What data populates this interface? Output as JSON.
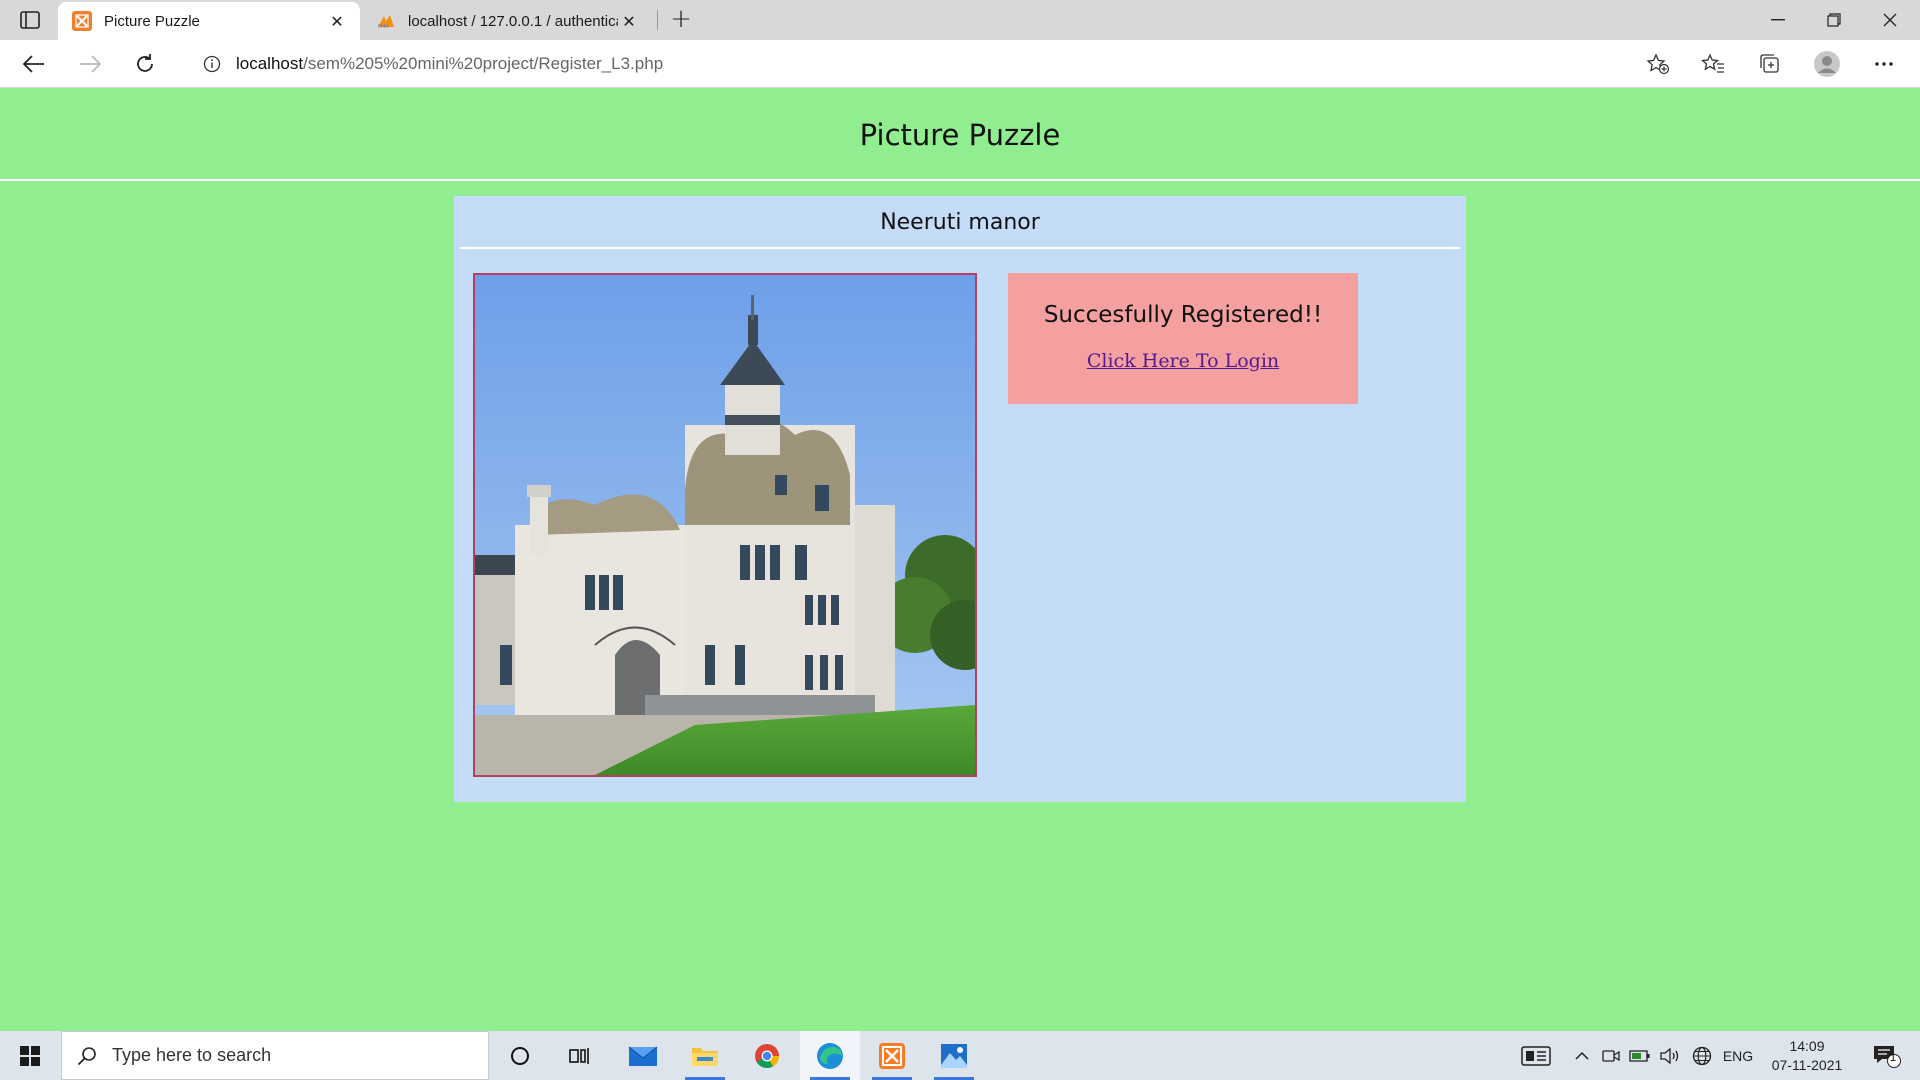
{
  "browser": {
    "tabs": [
      {
        "title": "Picture Puzzle",
        "active": true
      },
      {
        "title": "localhost / 127.0.0.1 / authentica",
        "active": false
      }
    ],
    "url_host": "localhost",
    "url_path": "/sem%205%20mini%20project/Register_L3.php"
  },
  "page": {
    "header_title": "Picture Puzzle",
    "card_title": "Neeruti manor",
    "message": "Succesfully Registered!!",
    "login_link": "Click Here To Login"
  },
  "taskbar": {
    "search_placeholder": "Type here to search",
    "language": "ENG",
    "time": "14:09",
    "date": "07-11-2021",
    "notification_count": "1"
  },
  "colors": {
    "page_bg": "#90EE90",
    "card_bg": "#c5dcf8",
    "message_bg": "#f4a0a0",
    "photo_border": "#b0405e"
  }
}
